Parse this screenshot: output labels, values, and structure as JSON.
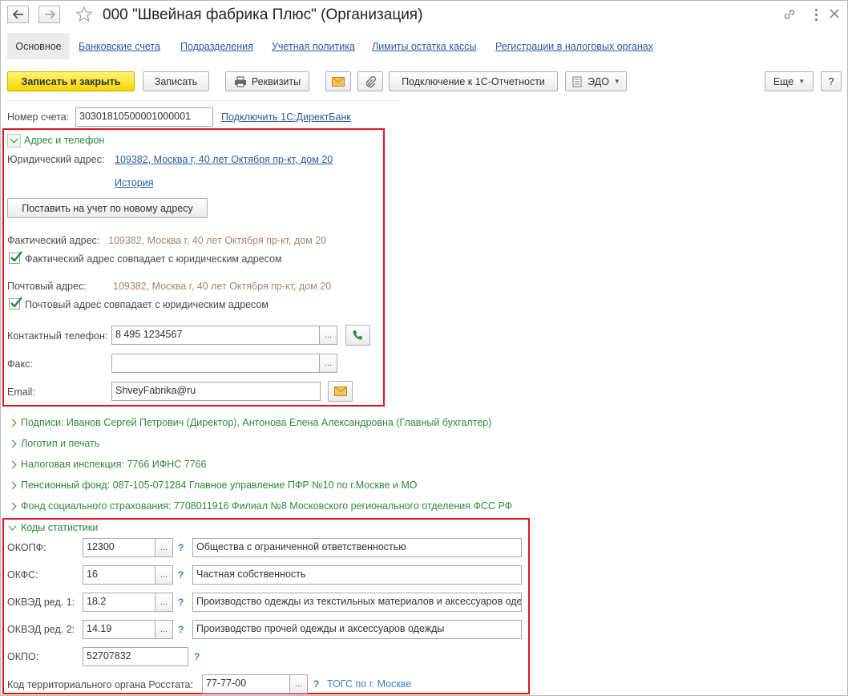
{
  "window": {
    "title": "000 \"Швейная фабрика Плюс\" (Организация)"
  },
  "tabs": [
    {
      "label": "Основное"
    },
    {
      "label": "Банковские счета"
    },
    {
      "label": "Подразделения"
    },
    {
      "label": "Учетная политика"
    },
    {
      "label": "Лимиты остатка кассы"
    },
    {
      "label": "Регистрации в налоговых органах"
    }
  ],
  "toolbar": {
    "save_close": "Записать и закрыть",
    "save": "Записать",
    "requisites": "Реквизиты",
    "connect_reporting": "Подключение к 1С-Отчетности",
    "edo": "ЭДО",
    "more": "Еще",
    "help": "?"
  },
  "account": {
    "label": "Номер счета:",
    "value": "30301810500001000001",
    "direct_bank_link": "Подключить 1С:ДиректБанк"
  },
  "address_group": {
    "title": "Адрес и телефон",
    "legal_label": "Юридический адрес:",
    "legal_value": "109382, Москва г, 40 лет Октября пр-кт, дом 20",
    "history_link": "История",
    "register_new_button": "Поставить на учет по новому адресу",
    "actual_label": "Фактический адрес:",
    "actual_value": "109382, Москва г, 40 лет Октября пр-кт, дом 20",
    "actual_same_check": "Фактический адрес совпадает с юридическим адресом",
    "actual_same_checked": true,
    "postal_label": "Почтовый адрес:",
    "postal_value": "109382, Москва г, 40 лет Октября пр-кт, дом 20",
    "postal_same_check": "Почтовый адрес совпадает с юридическим адресом",
    "postal_same_checked": true,
    "phone_label": "Контактный телефон:",
    "phone_value": "8 495 1234567",
    "fax_label": "Факс:",
    "fax_value": "",
    "email_label": "Email:",
    "email_value": "ShveyFabrika@ru",
    "dots": "..."
  },
  "collapsed_groups": [
    {
      "label": "Подписи: Иванов Сергей Петрович (Директор), Антонова Елена Александровна (Главный бухгалтер)"
    },
    {
      "label": "Логотип и печать"
    },
    {
      "label": "Налоговая инспекция: 7766 ИФНС 7766"
    },
    {
      "label": "Пенсионный фонд: 087-105-071284 Главное управление ПФР №10 по г.Москве и МО"
    },
    {
      "label": "Фонд социального страхования: 7708011916 Филиал №8 Московского регионального отделения ФСС РФ"
    }
  ],
  "stats_group": {
    "title": "Коды статистики",
    "rows": [
      {
        "label": "ОКОПФ:",
        "code": "12300",
        "desc": "Общества с ограниченной ответственностью"
      },
      {
        "label": "ОКФС:",
        "code": "16",
        "desc": "Частная собственность"
      },
      {
        "label": "ОКВЭД ред. 1:",
        "code": "18.2",
        "desc": "Производство одежды из текстильных материалов и аксессуаров одежды"
      },
      {
        "label": "ОКВЭД ред. 2:",
        "code": "14.19",
        "desc": "Производство прочей одежды и аксессуаров одежды"
      }
    ],
    "okpo_label": "ОКПО:",
    "okpo_value": "52707832",
    "rosstat_label": "Код территориального органа Росстата:",
    "rosstat_value": "77-77-00",
    "rosstat_link": "ТОГС по г. Москве",
    "help": "?"
  },
  "colors": {
    "accent_green": "#2f8a3c",
    "link_blue": "#2a5d9c",
    "highlight_red": "#e0151d",
    "primary_yellow": "#f5d500"
  }
}
